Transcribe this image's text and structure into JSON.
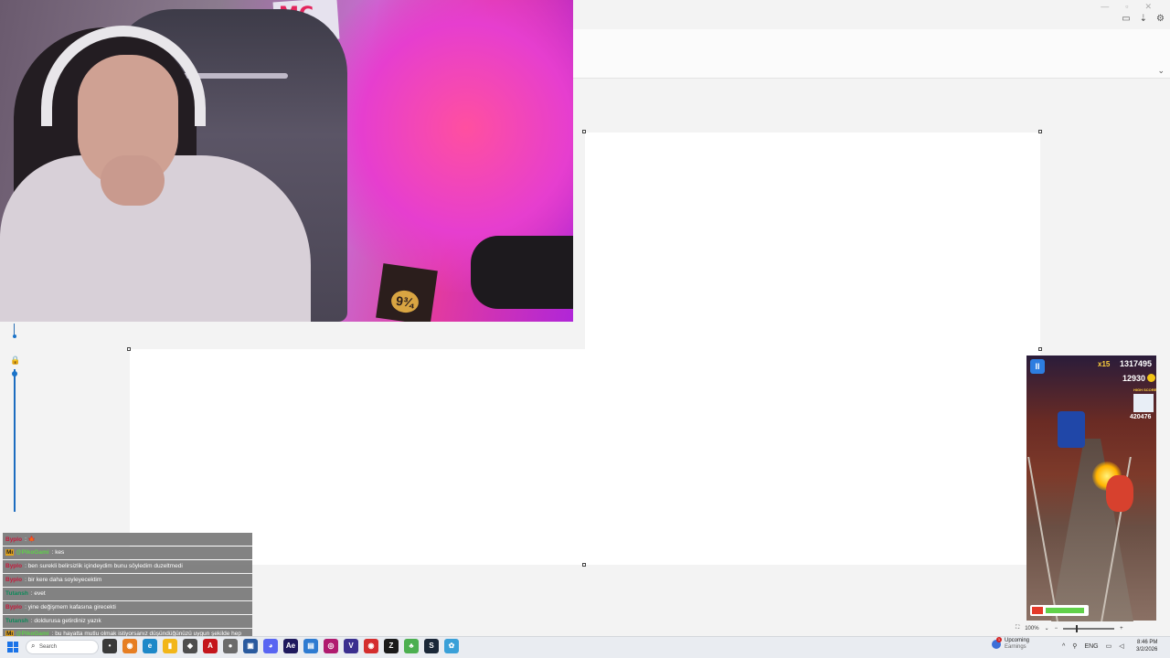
{
  "window": {
    "controls": {
      "minimize": "—",
      "restore": "▫",
      "close": "✕"
    },
    "toolbar_icons": [
      "comment-icon",
      "share-icon",
      "settings-icon"
    ]
  },
  "webcam": {
    "poster_text": "MC",
    "box_label": "9¾"
  },
  "chat": {
    "messages": [
      {
        "user": "Byplo",
        "text": "🍁",
        "user_color": "#c41a3b"
      },
      {
        "user": "@PikoGami",
        "text": "kes",
        "user_color": "#5fd14a",
        "badge": "Mı"
      },
      {
        "user": "Byplo",
        "text": "ben surekli belirsizlik içindeydim bunu söyledim duzeltmedi",
        "user_color": "#c41a3b"
      },
      {
        "user": "Byplo",
        "text": "bir kere daha soyleyecektim",
        "user_color": "#c41a3b"
      },
      {
        "user": "Tutansh",
        "text": "evet",
        "user_color": "#0e8a5a"
      },
      {
        "user": "Byplo",
        "text": "yine değişmem kafasına girecekti",
        "user_color": "#c41a3b"
      },
      {
        "user": "Tutansh",
        "text": "doldurusa getirdiniz yazık",
        "user_color": "#0e8a5a"
      },
      {
        "user": "@PikoGami",
        "text": "bu hayatta mutlu olmak istiyorsanız düşündüğünüzü uygun şekilde hep ortaya koymanız gerek",
        "user_color": "#5fd14a",
        "badge": "Mı"
      }
    ]
  },
  "game": {
    "pause_label": "II",
    "multiplier": "x15",
    "score": "1317495",
    "coins": "12930",
    "highscore_label": "HIGH SCORE",
    "best": "420476"
  },
  "statusbar": {
    "fit_icon": "fit-to-window-icon",
    "zoom": "100%",
    "zoom_out": "−",
    "zoom_in": "+",
    "zoom_fraction": 0.25
  },
  "taskbar": {
    "search_placeholder": "Search",
    "apps": [
      {
        "name": "app-1",
        "glyph": "•",
        "color": "#3a3a3a"
      },
      {
        "name": "app-2",
        "glyph": "◉",
        "color": "#e67e22"
      },
      {
        "name": "edge",
        "glyph": "e",
        "color": "#1e88c8"
      },
      {
        "name": "file-explorer",
        "glyph": "▮",
        "color": "#f2b619"
      },
      {
        "name": "app-5",
        "glyph": "◆",
        "color": "#4e4e4e"
      },
      {
        "name": "acrobat",
        "glyph": "A",
        "color": "#c4161c"
      },
      {
        "name": "app-7",
        "glyph": "●",
        "color": "#6b6b6b"
      },
      {
        "name": "app-8",
        "glyph": "▣",
        "color": "#2a5a9e"
      },
      {
        "name": "discord",
        "glyph": "◕",
        "color": "#5865f2"
      },
      {
        "name": "after-effects",
        "glyph": "Ae",
        "color": "#1f1a5e"
      },
      {
        "name": "app-11",
        "glyph": "▤",
        "color": "#2e7bd1"
      },
      {
        "name": "app-12",
        "glyph": "◎",
        "color": "#b01b6f"
      },
      {
        "name": "app-13",
        "glyph": "V",
        "color": "#3b2f8f"
      },
      {
        "name": "app-14",
        "glyph": "◉",
        "color": "#d42e2e"
      },
      {
        "name": "app-15",
        "glyph": "Z",
        "color": "#1a1a1a"
      },
      {
        "name": "app-16",
        "glyph": "♣",
        "color": "#4caf50"
      },
      {
        "name": "steam",
        "glyph": "S",
        "color": "#1b2838"
      },
      {
        "name": "app-18",
        "glyph": "✿",
        "color": "#3aa0d8"
      }
    ]
  },
  "weather": {
    "badge": "1",
    "title": "Upcoming",
    "subtitle": "Earnings"
  },
  "tray": {
    "chevron": "^",
    "language": "ENG"
  },
  "clock": {
    "time": "8:46 PM",
    "date": "3/2/2026"
  }
}
